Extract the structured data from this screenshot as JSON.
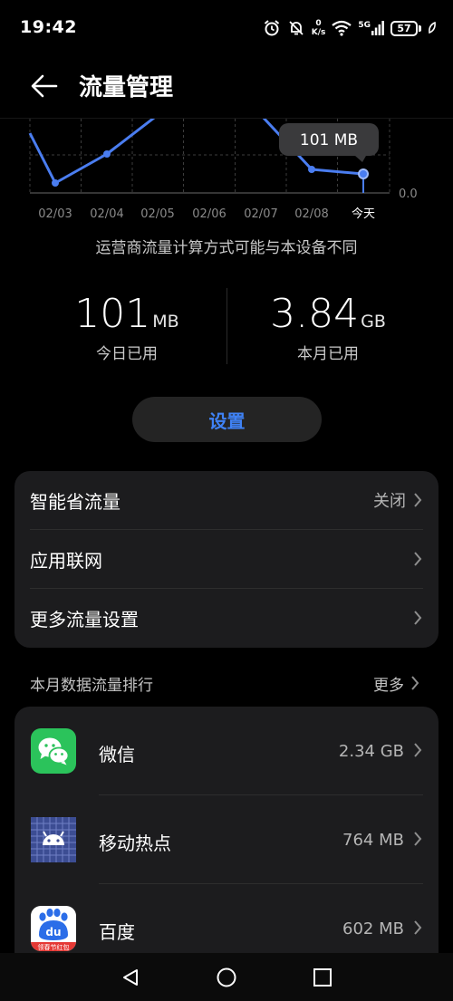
{
  "status": {
    "time": "19:42",
    "net_speed_value": "0",
    "net_speed_unit": "K/s",
    "network": "5G",
    "battery": "57"
  },
  "header": {
    "title": "流量管理"
  },
  "chart_data": {
    "type": "line",
    "categories": [
      "02/03",
      "02/04",
      "02/05",
      "02/06",
      "02/07",
      "02/08",
      "今天"
    ],
    "series": [
      {
        "values": [
          null,
          null,
          null,
          null,
          null,
          null,
          101
        ]
      }
    ],
    "tooltip": "101 MB",
    "y_zero_label": "0.0",
    "grid": true
  },
  "caption": "运营商流量计算方式可能与本设备不同",
  "stats": {
    "today": {
      "value": "101",
      "unit": "MB",
      "label": "今日已用"
    },
    "month": {
      "value": "3.84",
      "unit": "GB",
      "label": "本月已用"
    }
  },
  "settings_button": "设置",
  "menu": [
    {
      "label": "智能省流量",
      "value": "关闭"
    },
    {
      "label": "应用联网",
      "value": ""
    },
    {
      "label": "更多流量设置",
      "value": ""
    }
  ],
  "ranking": {
    "title": "本月数据流量排行",
    "more": "更多",
    "apps": [
      {
        "name": "微信",
        "size": "2.34 GB",
        "icon": "wechat-icon",
        "color": "#2bc35b"
      },
      {
        "name": "移动热点",
        "size": "764 MB",
        "icon": "android-icon",
        "color": "#3c4d93"
      },
      {
        "name": "百度",
        "size": "602 MB",
        "icon": "baidu-icon",
        "color": "#2b6de8",
        "badge": "领春节红包"
      }
    ]
  },
  "colors": {
    "accent": "#3f82f5",
    "background": "#000000",
    "card": "#1c1c1e"
  }
}
